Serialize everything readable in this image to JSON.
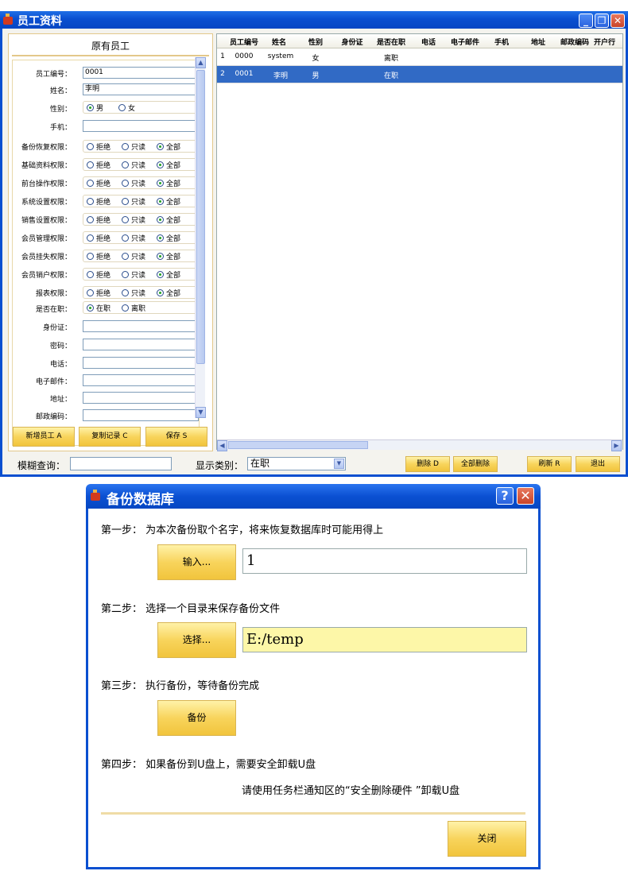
{
  "main_window": {
    "title": "员工资料"
  },
  "panel": {
    "title": "原有员工"
  },
  "fields": {
    "id_label": "员工编号：",
    "id_value": "0001",
    "name_label": "姓名：",
    "name_value": "李明",
    "gender_label": "性别：",
    "gender_opts": [
      "男",
      "女"
    ],
    "mobile_label": "手机：",
    "perms": [
      {
        "label": "备份恢复权限："
      },
      {
        "label": "基础资料权限："
      },
      {
        "label": "前台操作权限："
      },
      {
        "label": "系统设置权限："
      },
      {
        "label": "销售设置权限："
      },
      {
        "label": "会员管理权限："
      },
      {
        "label": "会员挂失权限："
      },
      {
        "label": "会员销户权限："
      },
      {
        "label": "报表权限："
      }
    ],
    "perm_opts": [
      "拒绝",
      "只读",
      "全部"
    ],
    "active_label": "是否在职：",
    "active_opts": [
      "在职",
      "离职"
    ],
    "idcard_label": "身份证：",
    "pwd_label": "密码：",
    "phone_label": "电话：",
    "email_label": "电子邮件：",
    "addr_label": "地址：",
    "zip_label": "邮政编码："
  },
  "panel_buttons": {
    "new": "新增员工 A",
    "copy": "复制记录 C",
    "save": "保存 S"
  },
  "grid": {
    "headers": [
      "员工编号",
      "姓名",
      "性别",
      "身份证",
      "是否在职",
      "电话",
      "电子邮件",
      "手机",
      "地址",
      "邮政编码",
      "开户行"
    ],
    "rows": [
      {
        "n": "1",
        "id": "0000",
        "name": "system",
        "gender": "女",
        "active": "离职"
      },
      {
        "n": "2",
        "id": "0001",
        "name": "李明",
        "gender": "男",
        "active": "在职"
      }
    ]
  },
  "bottom": {
    "search_label": "模糊查询：",
    "filter_label": "显示类别：",
    "filter_value": "在职",
    "btn_delete": "删除 D",
    "btn_delete_all": "全部删除",
    "btn_refresh": "刷新 R",
    "btn_exit": "退出"
  },
  "dialog": {
    "title": "备份数据库",
    "step1": "第一步：  为本次备份取个名字，将来恢复数据库时可能用得上",
    "btn_input": "输入...",
    "name_value": "1",
    "step2": "第二步：  选择一个目录来保存备份文件",
    "btn_choose": "选择...",
    "dir_value": "E:/temp",
    "step3": "第三步：  执行备份，等待备份完成",
    "btn_backup": "备份",
    "step4": "第四步：  如果备份到U盘上，需要安全卸载U盘",
    "step4_note": "请使用任务栏通知区的“安全删除硬件 ”卸载U盘",
    "btn_close": "关闭"
  },
  "colors": {
    "titlebar": "#0a4fd0",
    "selected_row": "#316ac5",
    "button_yellow": "#f8d45c"
  }
}
